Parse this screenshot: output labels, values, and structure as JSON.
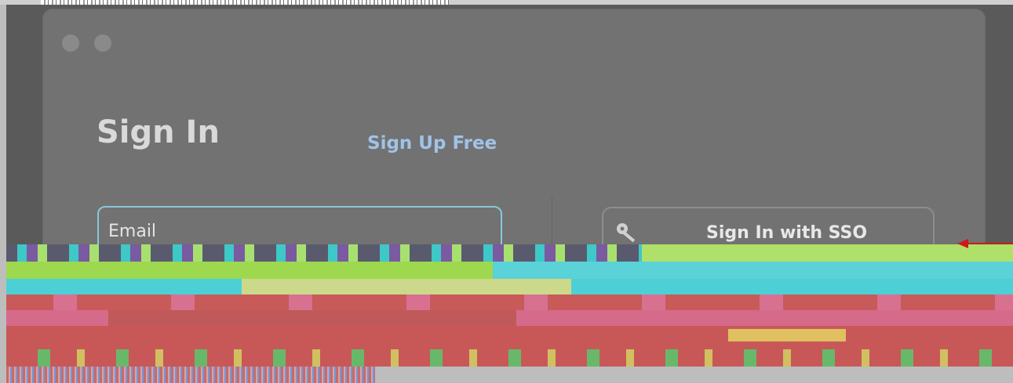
{
  "window": {
    "title": "Sign In",
    "signup_link": "Sign Up Free"
  },
  "email_field": {
    "placeholder": "Email",
    "value": ""
  },
  "sso_button": {
    "label": "Sign In with SSO",
    "icon": "key-icon"
  },
  "colors": {
    "link": "#9fc3e7",
    "field_focus_border": "#88c7d9",
    "window_bg": "#727272",
    "pointer_arrow": "#d11818"
  }
}
